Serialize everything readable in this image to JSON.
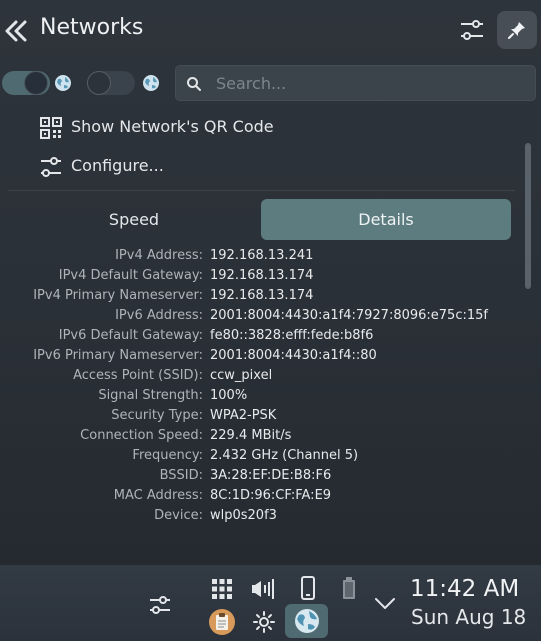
{
  "header": {
    "title": "Networks"
  },
  "search": {
    "placeholder": "Search..."
  },
  "actions": {
    "qr_label": "Show Network's QR Code",
    "configure_label": "Configure..."
  },
  "tabs": {
    "speed": "Speed",
    "details": "Details",
    "active": "Details"
  },
  "details": [
    {
      "label": "IPv4 Address:",
      "value": "192.168.13.241"
    },
    {
      "label": "IPv4 Default Gateway:",
      "value": "192.168.13.174"
    },
    {
      "label": "IPv4 Primary Nameserver:",
      "value": "192.168.13.174"
    },
    {
      "label": "IPv6 Address:",
      "value": "2001:8004:4430:a1f4:7927:8096:e75c:15f"
    },
    {
      "label": "IPv6 Default Gateway:",
      "value": "fe80::3828:efff:fede:b8f6"
    },
    {
      "label": "IPv6 Primary Nameserver:",
      "value": "2001:8004:4430:a1f4::80"
    },
    {
      "label": "Access Point (SSID):",
      "value": "ccw_pixel"
    },
    {
      "label": "Signal Strength:",
      "value": "100%"
    },
    {
      "label": "Security Type:",
      "value": "WPA2-PSK"
    },
    {
      "label": "Connection Speed:",
      "value": "229.4 MBit/s"
    },
    {
      "label": "Frequency:",
      "value": "2.432 GHz (Channel 5)"
    },
    {
      "label": "BSSID:",
      "value": "3A:28:EF:DE:B8:F6"
    },
    {
      "label": "MAC Address:",
      "value": "8C:1D:96:CF:FA:E9"
    },
    {
      "label": "Device:",
      "value": "wlp0s20f3"
    }
  ],
  "taskbar": {
    "time": "11:42 AM",
    "date": "Sun Aug 18"
  },
  "colors": {
    "accent": "#5d7c80",
    "toggle_on": "#4f6a70",
    "background": "#2a3037"
  },
  "icons": [
    "back-icon",
    "configure-icon",
    "pin-icon",
    "globe-icon",
    "search-icon",
    "qr-code-icon",
    "configure-icon",
    "apps-grid-icon",
    "volume-icon",
    "phone-icon",
    "battery-icon",
    "clipboard-icon",
    "brightness-icon",
    "network-icon",
    "chevron-down-icon"
  ]
}
